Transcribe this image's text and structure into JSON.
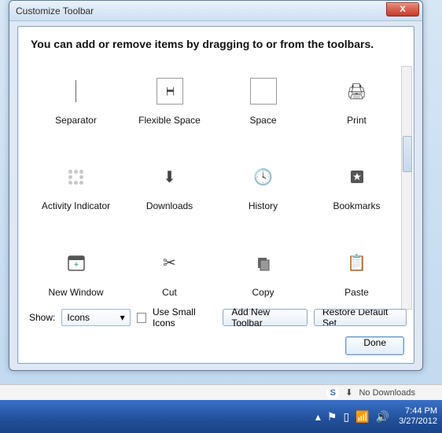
{
  "window": {
    "title": "Customize Toolbar",
    "close_glyph": "X",
    "instruction": "You can add or remove items by dragging to or from the toolbars."
  },
  "items": [
    {
      "label": "Separator",
      "icon": "separator-icon"
    },
    {
      "label": "Flexible Space",
      "icon": "flexible-space-icon"
    },
    {
      "label": "Space",
      "icon": "space-icon"
    },
    {
      "label": "Print",
      "icon": "print-icon"
    },
    {
      "label": "Activity Indicator",
      "icon": "activity-indicator-icon"
    },
    {
      "label": "Downloads",
      "icon": "downloads-icon"
    },
    {
      "label": "History",
      "icon": "history-icon"
    },
    {
      "label": "Bookmarks",
      "icon": "bookmarks-icon"
    },
    {
      "label": "New Window",
      "icon": "new-window-icon"
    },
    {
      "label": "Cut",
      "icon": "cut-icon"
    },
    {
      "label": "Copy",
      "icon": "copy-icon"
    },
    {
      "label": "Paste",
      "icon": "paste-icon"
    }
  ],
  "footer": {
    "show_label": "Show:",
    "show_value": "Icons",
    "small_icons_label": "Use Small Icons",
    "small_icons_checked": false,
    "add_toolbar_label": "Add New Toolbar",
    "restore_label": "Restore Default Set",
    "done_label": "Done"
  },
  "statusbar": {
    "downloads_text": "No Downloads"
  },
  "taskbar": {
    "time": "7:44 PM",
    "date": "3/27/2012"
  }
}
